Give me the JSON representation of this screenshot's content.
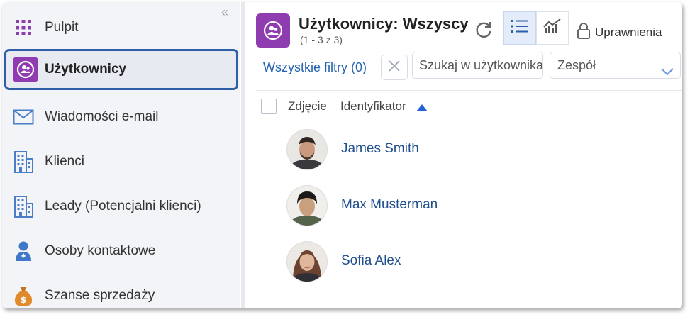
{
  "sidebar": {
    "items": [
      {
        "label": "Pulpit",
        "icon": "grid-icon"
      },
      {
        "label": "Użytkownicy",
        "icon": "users-icon"
      },
      {
        "label": "Wiadomości e-mail",
        "icon": "envelope-icon"
      },
      {
        "label": "Klienci",
        "icon": "building-icon"
      },
      {
        "label": "Leady (Potencjalni klienci)",
        "icon": "building-icon"
      },
      {
        "label": "Osoby kontaktowe",
        "icon": "person-icon"
      },
      {
        "label": "Szanse sprzedaży",
        "icon": "money-bag-icon"
      }
    ],
    "active_index": 1,
    "collapse_glyph": "«"
  },
  "header": {
    "title": "Użytkownicy: Wszyscy",
    "subtitle": "(1 - 3 z 3)",
    "permissions_label": "Uprawnienia"
  },
  "filters": {
    "all_filters_label": "Wszystkie filtry (0)",
    "search_placeholder": "Szukaj w użytkownikach",
    "team_placeholder": "Zespół"
  },
  "table": {
    "columns": [
      "Zdjęcie",
      "Identyfikator"
    ],
    "sort_column": "Identyfikator",
    "sort_direction": "asc",
    "rows": [
      {
        "name": "James Smith"
      },
      {
        "name": "Max Musterman"
      },
      {
        "name": "Sofia Alex"
      }
    ]
  },
  "colors": {
    "accent_purple": "#8e3cb0",
    "link_blue": "#1f4e8c",
    "active_border": "#2e5fa6",
    "arrow_blue": "#2b5ea8"
  }
}
